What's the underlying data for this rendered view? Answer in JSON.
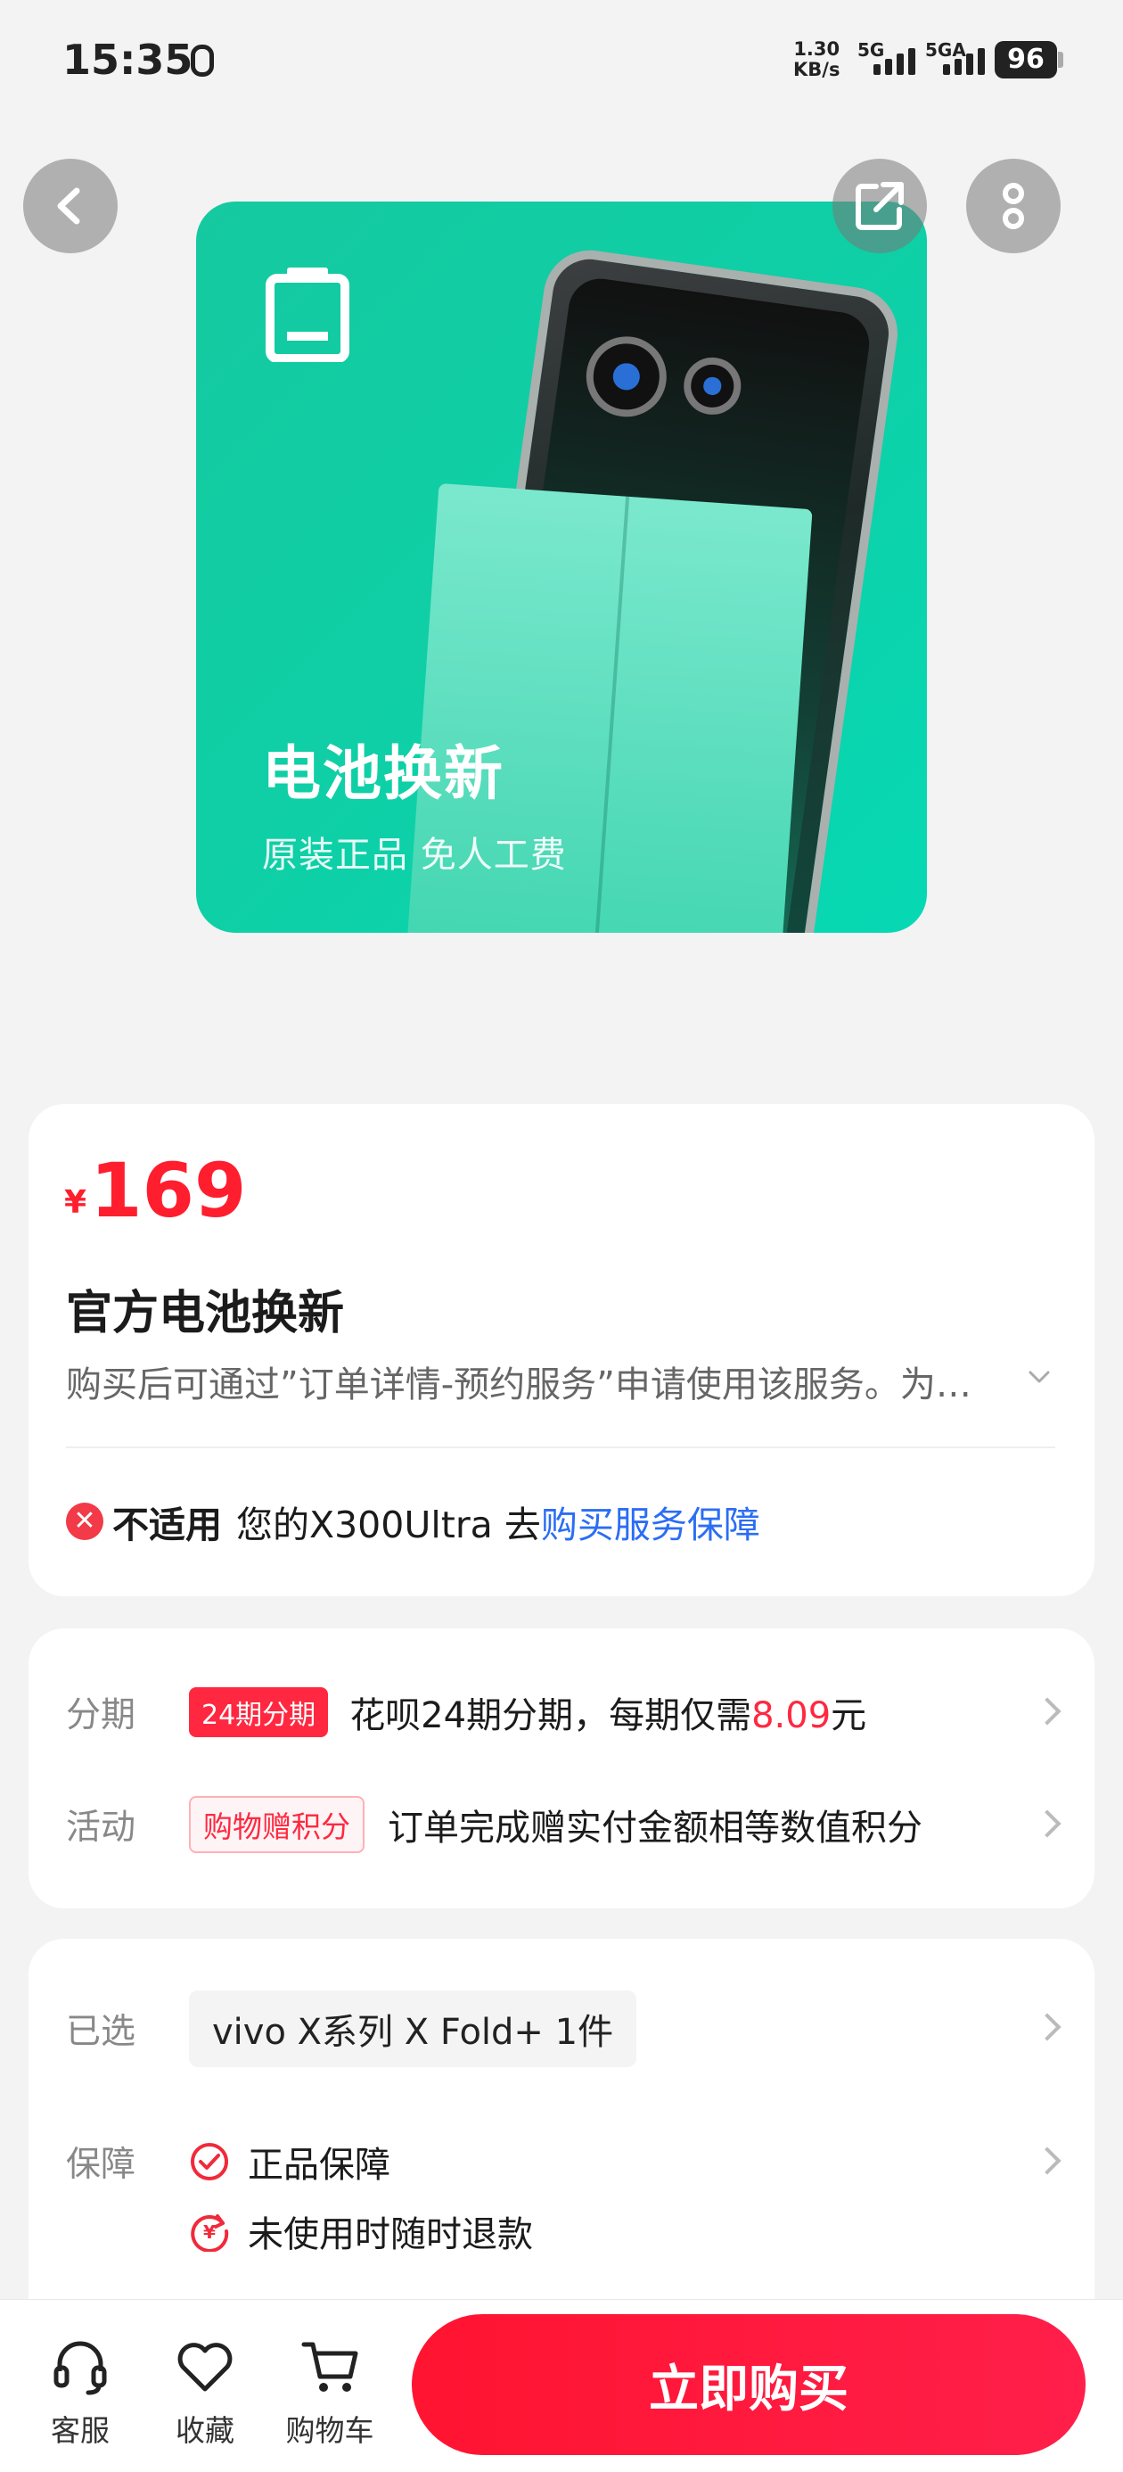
{
  "status_bar": {
    "time": "15:35",
    "net_speed_top": "1.30",
    "net_speed_bottom": "KB/s",
    "sim1": "5G",
    "sim2": "5GA",
    "battery": "96"
  },
  "header": {
    "back_icon": "chevron-left-icon",
    "share_icon": "share-icon",
    "more_icon": "more-vertical-icon"
  },
  "hero": {
    "title": "电池换新",
    "subtitle": "原装正品 免人工费",
    "icon": "battery-icon",
    "bg_color": "#15c9a0"
  },
  "product": {
    "currency": "¥",
    "price": "169",
    "title": "官方电池换新",
    "description": "购买后可通过”订单详情-预约服务”申请使用该服务。为…",
    "not_applicable_label": "不适用",
    "not_applicable_text": "您的X300Ultra 去",
    "not_applicable_link": "购买服务保障"
  },
  "offers": {
    "installment": {
      "label": "分期",
      "tag": "24期分期",
      "text_prefix": "花呗24期分期，每期仅需",
      "amount": "8.09",
      "text_suffix": "元"
    },
    "activity": {
      "label": "活动",
      "tag": "购物赠积分",
      "text": "订单完成赠实付金额相等数值积分"
    }
  },
  "selection": {
    "selected_label": "已选",
    "selected_value": "vivo X系列 X Fold+ 1件",
    "guarantee_label": "保障",
    "guarantees": [
      "正品保障",
      "未使用时随时退款"
    ]
  },
  "bottom_bar": {
    "service": "客服",
    "favorite": "收藏",
    "cart": "购物车",
    "buy": "立即购买"
  },
  "colors": {
    "accent_red": "#ff1e2e",
    "link_blue": "#2b6df5",
    "hero_green": "#15c9a0"
  }
}
